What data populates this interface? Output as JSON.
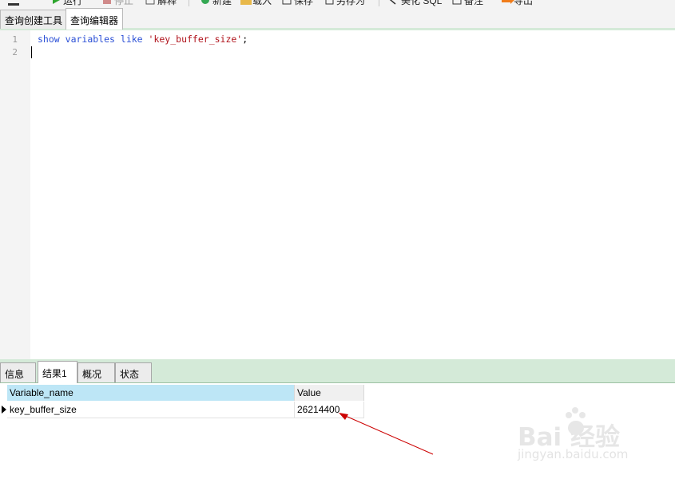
{
  "toolbar": {
    "items": [
      {
        "label": "运行",
        "icon": "run-icon",
        "color": "#2da52d"
      },
      {
        "label": "停止",
        "icon": "stop-icon",
        "color": "#c44a4a"
      },
      {
        "label": "解释",
        "icon": "explain-icon"
      },
      {
        "label": "新建",
        "icon": "new-icon",
        "color": "#34a853"
      },
      {
        "label": "载入",
        "icon": "load-icon",
        "color": "#e8b84a"
      },
      {
        "label": "保存",
        "icon": "save-icon"
      },
      {
        "label": "另存为",
        "icon": "save-as-icon"
      },
      {
        "label": "美化 SQL",
        "icon": "beautify-icon"
      },
      {
        "label": "备注",
        "icon": "comment-icon"
      },
      {
        "label": "导出",
        "icon": "export-icon",
        "color": "#f07c1a"
      }
    ]
  },
  "tabs": [
    {
      "label": "查询创建工具",
      "active": false
    },
    {
      "label": "查询编辑器",
      "active": true
    }
  ],
  "editor": {
    "line_numbers": [
      "1",
      "2"
    ],
    "line1": {
      "kw1": "show",
      "kw2": "variables",
      "kw3": "like",
      "str": "'key_buffer_size'",
      "end": ";"
    }
  },
  "result_tabs": [
    {
      "label": "信息",
      "active": false
    },
    {
      "label": "结果1",
      "active": true
    },
    {
      "label": "概况",
      "active": false
    },
    {
      "label": "状态",
      "active": false
    }
  ],
  "grid": {
    "columns": [
      "Variable_name",
      "Value"
    ],
    "rows": [
      [
        "key_buffer_size",
        "26214400"
      ]
    ]
  },
  "colors": {
    "keyword": "#2a4fd6",
    "string": "#b0121b",
    "panel_green": "#d4ead8",
    "header_selected": "#bde6f6",
    "annotation_arrow": "#cc0000"
  },
  "watermark": {
    "brand": "Bai  经验",
    "url": "jingyan.baidu.com"
  }
}
